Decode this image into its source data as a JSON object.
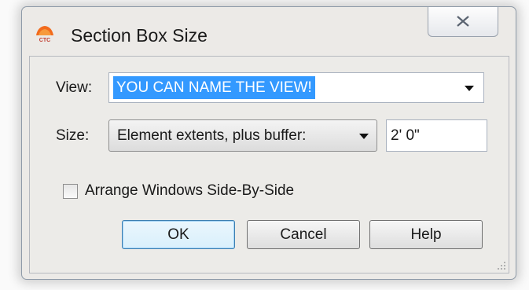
{
  "window": {
    "title": "Section Box Size",
    "app_icon": "ctc-tools-logo-icon",
    "close_icon": "close-icon"
  },
  "view": {
    "label": "View:",
    "value": "YOU CAN NAME THE VIEW!",
    "selected_highlight_color": "#3399ff"
  },
  "size": {
    "label": "Size:",
    "selected_option": "Element extents, plus buffer:",
    "buffer_value": "2' 0\""
  },
  "options": {
    "arrange_label": "Arrange Windows Side-By-Side",
    "arrange_checked": false
  },
  "buttons": {
    "ok": "OK",
    "cancel": "Cancel",
    "help": "Help"
  },
  "colors": {
    "dialog_background": "#eceae7",
    "default_button_border": "#3c7fb1"
  }
}
